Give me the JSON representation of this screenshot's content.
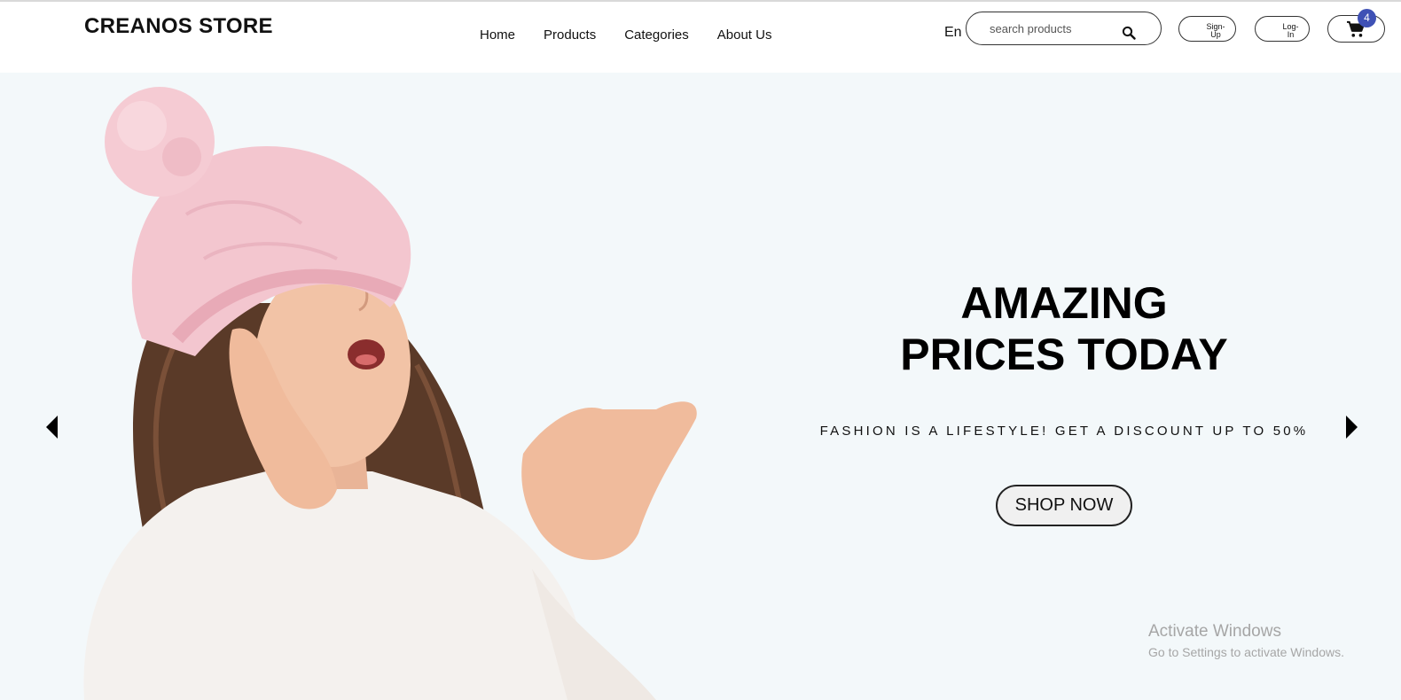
{
  "header": {
    "logo": "CREANOS STORE",
    "nav": [
      "Home",
      "Products",
      "Categories",
      "About Us"
    ],
    "language": "En",
    "search_placeholder": "search products",
    "signup_label": "Sign-\nUp",
    "login_label": "Log-\nIn",
    "cart_count": "4"
  },
  "hero": {
    "headline_line1": "AMAZING",
    "headline_line2": "PRICES TODAY",
    "subline": "FASHION IS A LIFESTYLE! GET A DISCOUNT UP TO 50%",
    "cta_label": "SHOP NOW"
  },
  "watermark": {
    "title": "Activate Windows",
    "subtitle": "Go to Settings to activate Windows."
  },
  "colors": {
    "hero_background": "#f3f8fa",
    "badge": "#3f51b5",
    "hat": "#f3c6cf",
    "hair": "#5a3a28",
    "sweater": "#f4f1ee",
    "skin": "#f2c3a6"
  },
  "icons": [
    "search-icon",
    "cart-icon",
    "chevron-left-icon",
    "chevron-right-icon"
  ]
}
